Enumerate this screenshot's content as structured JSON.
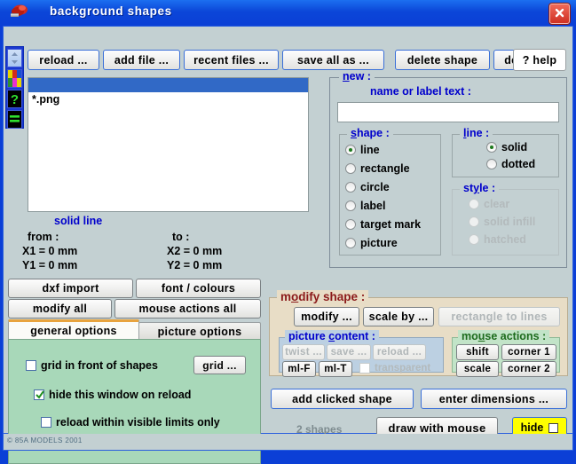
{
  "window": {
    "title": "background  shapes",
    "close_label": "close",
    "icon": "red-blob-icon"
  },
  "statusbar": {
    "copyright": "© 85A  MODELS  2001"
  },
  "sidebar": {
    "items": [
      {
        "name": "scroll-icon",
        "label": "scroll"
      },
      {
        "name": "palette-icon",
        "label": "colours"
      },
      {
        "name": "help-icon",
        "label": "?"
      },
      {
        "name": "menu-icon",
        "label": "="
      }
    ]
  },
  "toolbar": {
    "buttons": [
      {
        "label": "reload ...",
        "name": "reload-button",
        "style": "blue"
      },
      {
        "label": "add  file ...",
        "name": "add-file-button",
        "style": "blue"
      },
      {
        "label": "recent  files ...",
        "name": "recent-files-button",
        "style": "blue"
      },
      {
        "label": "save  all  as ...",
        "name": "save-all-as-button",
        "style": "blue"
      },
      {
        "label": "delete  shape",
        "name": "delete-shape-button",
        "style": "blue"
      },
      {
        "label": "delete  all",
        "name": "delete-all-button",
        "style": "blue"
      },
      {
        "label": "? help",
        "name": "help-button",
        "style": "help"
      }
    ]
  },
  "filelist": {
    "selected_row": "",
    "items": [
      "*.png"
    ]
  },
  "shape_info": {
    "heading": "solid  line",
    "from_label": "from :",
    "to_label": "to :",
    "x1": "X1 =   0  mm",
    "y1": "Y1 =   0  mm",
    "x2": "X2 =   0  mm",
    "y2": "Y2 =   0  mm"
  },
  "new_panel": {
    "title": "new :",
    "title_mnemonic": "n",
    "name_label": "name  or  label  text :",
    "name_value": "",
    "name_placeholder": "",
    "shape": {
      "title": "shape :",
      "title_mnemonic": "s",
      "options": [
        "line",
        "rectangle",
        "circle",
        "label",
        "target mark",
        "picture"
      ],
      "selected": "line"
    },
    "line": {
      "title": "line :",
      "title_mnemonic": "l",
      "options": [
        "solid",
        "dotted"
      ],
      "selected": "solid"
    },
    "style": {
      "title": "style :",
      "title_mnemonic": "y",
      "enabled": false,
      "options": [
        "clear",
        "solid infill",
        "hatched"
      ],
      "selected": "clear"
    }
  },
  "left_buttons": {
    "dxf_import": "dxf  import",
    "font_colours": "font / colours",
    "modify_all": "modify  all",
    "mouse_actions_all": "mouse  actions  all"
  },
  "tabs": [
    {
      "label": "general  options",
      "name": "tab-general-options",
      "active": true
    },
    {
      "label": "picture  options",
      "name": "tab-picture-options",
      "active": false
    }
  ],
  "general_options": {
    "grid_in_front": {
      "label": "grid  in  front  of  shapes",
      "checked": false
    },
    "grid_button": "grid ...",
    "hide_on_reload": {
      "label": "hide  this  window  on  reload",
      "checked": true
    },
    "reload_visible_only": {
      "label": "reload  within  visible  limits  only",
      "checked": false
    }
  },
  "modify_shape": {
    "title": "modify  shape :",
    "title_mnemonic": "o",
    "modify_button": "modify ...",
    "scale_by_button": "scale by ...",
    "rect_to_lines_button": "rectangle  to  lines",
    "rect_to_lines_enabled": false,
    "picture_content": {
      "title": "picture  content :",
      "title_mnemonic": "c",
      "twist": "twist ...",
      "save": "save ...",
      "reload": "reload ...",
      "ml_f": "ml-F",
      "ml_t": "ml-T",
      "transparent": {
        "label": "transparent",
        "checked": false,
        "enabled": false
      }
    },
    "mouse_actions": {
      "title": "mouse  actions :",
      "title_mnemonic": "u",
      "shift": "shift",
      "corner1": "corner 1",
      "scale": "scale",
      "corner2": "corner 2"
    }
  },
  "bottom": {
    "add_clicked_shape": "add  clicked  shape",
    "enter_dimensions": "enter  dimensions ...",
    "shape_count": "2  shapes",
    "draw_with_mouse": "draw  with  mouse",
    "hide": "hide",
    "hide_checked": false
  },
  "colors": {
    "titlebar": "#0b3fd6",
    "client": "#c3d0d2",
    "accent_blue": "#3a6fd8",
    "modify_title": "#8b1a1a",
    "green_panel": "#a8d8b9",
    "tan_panel": "#e8ddc6",
    "tab_active_top": "#e8a33d",
    "hide_yellow": "#ffff00",
    "heading_blue": "#0000cc"
  }
}
